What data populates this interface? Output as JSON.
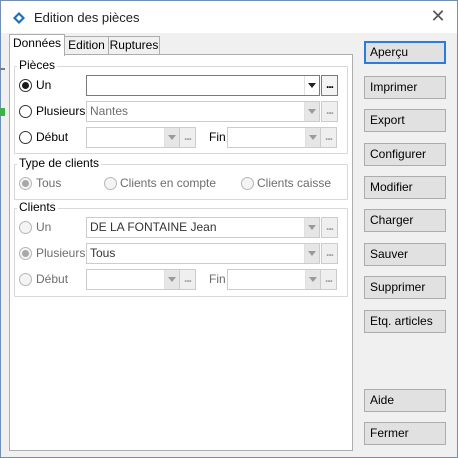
{
  "window": {
    "title": "Edition des pièces",
    "close_glyph": "✕"
  },
  "tabs": [
    {
      "label": "Données",
      "active": true
    },
    {
      "label": "Edition",
      "active": false
    },
    {
      "label": "Ruptures",
      "active": false
    }
  ],
  "pieces": {
    "legend": "Pièces",
    "un": {
      "label": "Un",
      "value": "",
      "checked": true
    },
    "plusieurs": {
      "label": "Plusieurs",
      "value": "Nantes"
    },
    "debut": {
      "label": "Début",
      "value": ""
    },
    "fin": {
      "label": "Fin",
      "value": ""
    },
    "dots": "..."
  },
  "type_clients": {
    "legend": "Type de clients",
    "options": [
      "Tous",
      "Clients en compte",
      "Clients caisse"
    ]
  },
  "clients": {
    "legend": "Clients",
    "un": {
      "label": "Un",
      "value": "DE LA FONTAINE Jean"
    },
    "plusieurs": {
      "label": "Plusieurs",
      "value": "Tous",
      "checked": true
    },
    "debut": {
      "label": "Début",
      "value": ""
    },
    "fin": {
      "label": "Fin",
      "value": ""
    },
    "dots": "..."
  },
  "buttons": {
    "apercu": "Aperçu",
    "imprimer": "Imprimer",
    "export": "Export",
    "configurer": "Configurer",
    "modifier": "Modifier",
    "charger": "Charger",
    "sauver": "Sauver",
    "supprimer": "Supprimer",
    "etq": "Etq. articles",
    "aide": "Aide",
    "fermer": "Fermer"
  },
  "colors": {
    "accent": "#2c7be0",
    "icon": "#1e6fb8"
  }
}
